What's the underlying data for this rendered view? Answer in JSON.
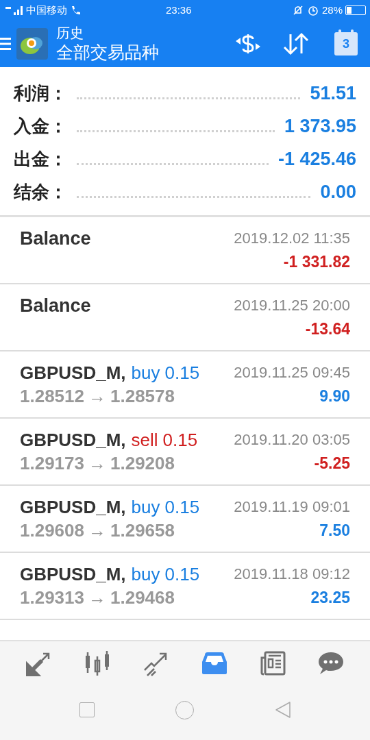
{
  "status_bar": {
    "carrier": "中国移动",
    "time": "23:36",
    "battery": "28%",
    "battery_meter": {
      "level": 0.28
    }
  },
  "header": {
    "title": "历史",
    "subtitle": "全部交易品种",
    "calendar_day": "3"
  },
  "summary": [
    {
      "label": "利润：",
      "value": "51.51"
    },
    {
      "label": "入金：",
      "value": "1 373.95"
    },
    {
      "label": "出金：",
      "value": "-1 425.46"
    },
    {
      "label": "结余：",
      "value": "0.00"
    }
  ],
  "deals": [
    {
      "kind": "balance",
      "title": "Balance",
      "time": "2019.12.02 11:35",
      "amount": "-1 331.82",
      "negative": true
    },
    {
      "kind": "balance",
      "title": "Balance",
      "time": "2019.11.25 20:00",
      "amount": "-13.64",
      "negative": true
    },
    {
      "kind": "trade",
      "symbol": "GBPUSD_M,",
      "side": "buy",
      "volume": "0.15",
      "sell": false,
      "open": "1.28512",
      "arrow": "→",
      "close": "1.28578",
      "time": "2019.11.25 09:45",
      "amount": "9.90",
      "negative": false
    },
    {
      "kind": "trade",
      "symbol": "GBPUSD_M,",
      "side": "sell",
      "volume": "0.15",
      "sell": true,
      "open": "1.29173",
      "arrow": "→",
      "close": "1.29208",
      "time": "2019.11.20 03:05",
      "amount": "-5.25",
      "negative": true
    },
    {
      "kind": "trade",
      "symbol": "GBPUSD_M,",
      "side": "buy",
      "volume": "0.15",
      "sell": false,
      "open": "1.29608",
      "arrow": "→",
      "close": "1.29658",
      "time": "2019.11.19 09:01",
      "amount": "7.50",
      "negative": false
    },
    {
      "kind": "trade",
      "symbol": "GBPUSD_M,",
      "side": "buy",
      "volume": "0.15",
      "sell": false,
      "open": "1.29313",
      "arrow": "→",
      "close": "1.29468",
      "time": "2019.11.18 09:12",
      "amount": "23.25",
      "negative": false
    }
  ],
  "bottom_nav": [
    {
      "kind": "quotes",
      "selected": false
    },
    {
      "kind": "chart",
      "selected": false
    },
    {
      "kind": "trade",
      "selected": false
    },
    {
      "kind": "history",
      "selected": true
    },
    {
      "kind": "news",
      "selected": false
    },
    {
      "kind": "chat",
      "selected": false
    }
  ]
}
